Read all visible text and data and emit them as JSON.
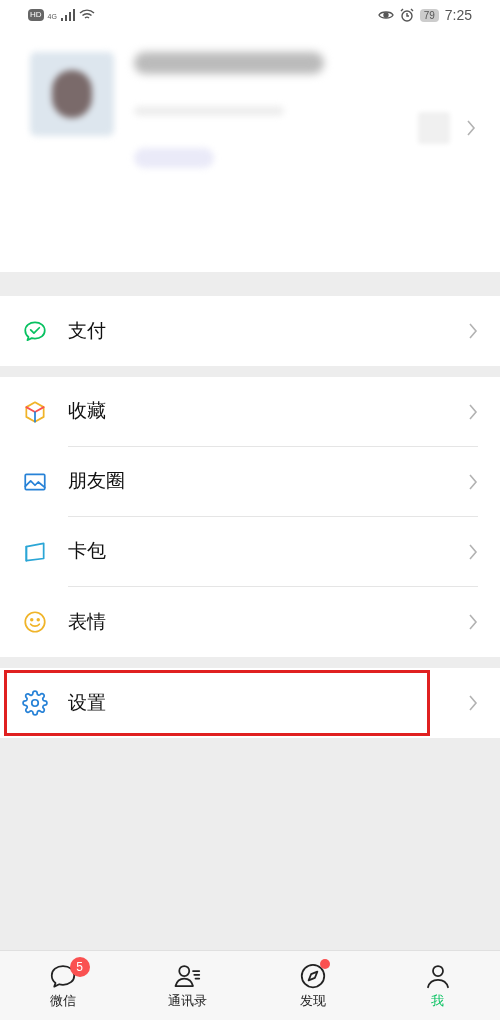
{
  "status_bar": {
    "time": "7:25",
    "battery": "79",
    "network": "4G",
    "hd": "HD"
  },
  "groups": [
    {
      "items": [
        {
          "kind": "pay",
          "label": "支付",
          "highlighted": false
        }
      ]
    },
    {
      "items": [
        {
          "kind": "favorites",
          "label": "收藏",
          "highlighted": false
        },
        {
          "kind": "moments",
          "label": "朋友圈",
          "highlighted": false
        },
        {
          "kind": "cards",
          "label": "卡包",
          "highlighted": false
        },
        {
          "kind": "stickers",
          "label": "表情",
          "highlighted": false
        }
      ]
    },
    {
      "items": [
        {
          "kind": "settings",
          "label": "设置",
          "highlighted": true
        }
      ]
    }
  ],
  "tabs": [
    {
      "kind": "chats",
      "label": "微信",
      "badge": "5",
      "dot": false,
      "selected": false
    },
    {
      "kind": "contacts",
      "label": "通讯录",
      "dot": false,
      "selected": false
    },
    {
      "kind": "discover",
      "label": "发现",
      "dot": true,
      "selected": false
    },
    {
      "kind": "me",
      "label": "我",
      "dot": false,
      "selected": true
    }
  ]
}
